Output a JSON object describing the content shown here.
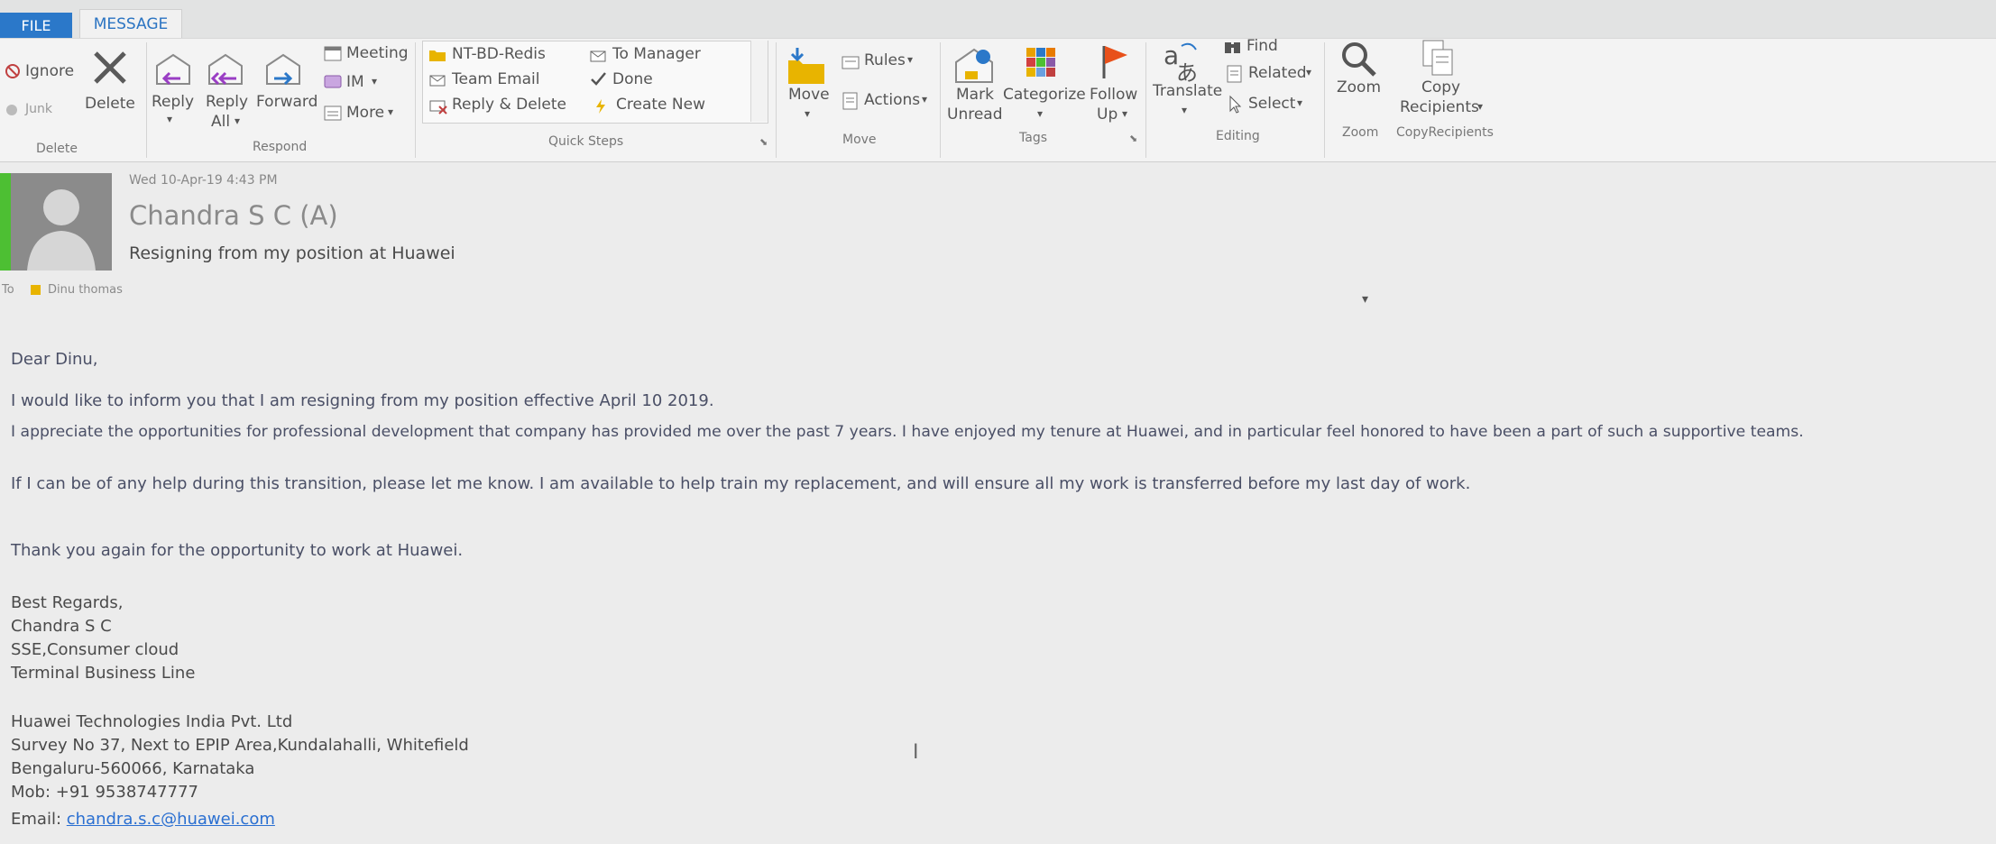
{
  "tabs": {
    "file": "FILE",
    "message": "MESSAGE"
  },
  "ribbon": {
    "delete_group": {
      "ignore": "Ignore",
      "junk": "Junk",
      "delete": "Delete",
      "label": "Delete"
    },
    "respond_group": {
      "reply": "Reply",
      "reply_all_line1": "Reply",
      "reply_all_line2": "All",
      "forward": "Forward",
      "meeting": "Meeting",
      "im": "IM",
      "more": "More",
      "label": "Respond"
    },
    "quick_steps": {
      "items": [
        "NT-BD-Redis",
        "To Manager",
        "Team Email",
        "Done",
        "Reply & Delete",
        "Create New"
      ],
      "label": "Quick Steps"
    },
    "move_group": {
      "move": "Move",
      "rules": "Rules",
      "actions": "Actions",
      "label": "Move"
    },
    "tags_group": {
      "mark_unread_line1": "Mark",
      "mark_unread_line2": "Unread",
      "categorize": "Categorize",
      "follow_up_line1": "Follow",
      "follow_up_line2": "Up",
      "label": "Tags"
    },
    "editing_group": {
      "translate": "Translate",
      "find": "Find",
      "related": "Related",
      "select": "Select",
      "label": "Editing"
    },
    "zoom_group": {
      "zoom": "Zoom",
      "label": "Zoom"
    },
    "copy_group": {
      "copy_line1": "Copy",
      "copy_line2": "Recipients",
      "label": "CopyRecipients"
    }
  },
  "message": {
    "date": "Wed 10-Apr-19 4:43 PM",
    "sender": "Chandra S C (A)",
    "subject": "Resigning from my position at Huawei",
    "to_label": "To",
    "to_name": "Dinu thomas",
    "body": [
      "Dear Dinu,",
      "I would like to inform you that I am resigning from my position effective April 10 2019.",
      "I appreciate the opportunities for professional development that company has provided me over the past 7 years. I have enjoyed my tenure at Huawei, and in particular feel honored to have been a part of such a supportive teams.",
      "If I can be of any help during this transition, please let me know. I am available to help train my replacement, and will ensure all my work is transferred before my last day of work.",
      "Thank you again for the opportunity to work at Huawei."
    ],
    "signature": [
      "Best Regards,",
      "Chandra S C",
      "SSE,Consumer cloud",
      "Terminal Business Line",
      "Huawei Technologies India Pvt. Ltd",
      "Survey No 37, Next to EPIP Area,Kundalahalli, Whitefield",
      "Bengaluru-560066, Karnataka",
      "Mob: +91 9538747777"
    ],
    "email_label": "Email:",
    "email": "chandra.s.c@huawei.com"
  },
  "colors": {
    "file_tab": "#2b78c9",
    "presence": "#4dbf33",
    "link": "#2a6fd1",
    "body_text": "#4a4f66"
  }
}
